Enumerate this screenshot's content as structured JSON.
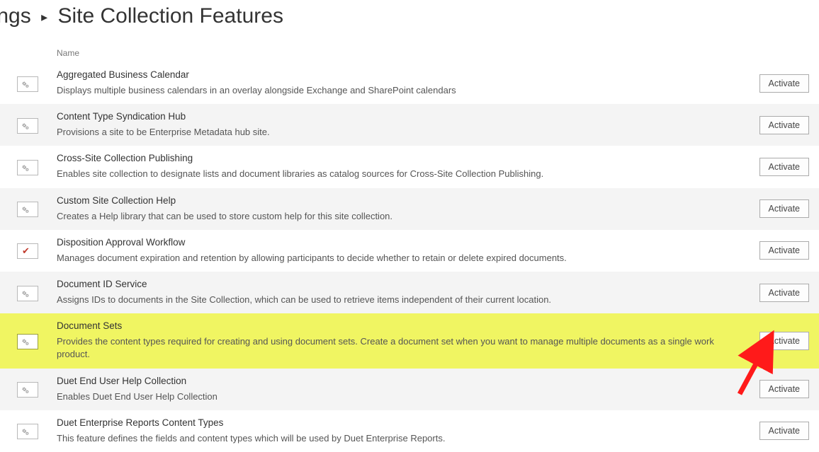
{
  "breadcrumb": {
    "prev_fragment": "ttings",
    "current": "Site Collection Features"
  },
  "columns": {
    "name": "Name"
  },
  "activate_label": "Activate",
  "features": [
    {
      "title": "Aggregated Business Calendar",
      "desc": "Displays multiple business calendars in an overlay alongside Exchange and SharePoint calendars",
      "icon": "gear",
      "alt": false,
      "highlight": false
    },
    {
      "title": "Content Type Syndication Hub",
      "desc": "Provisions a site to be Enterprise Metadata hub site.",
      "icon": "gear",
      "alt": true,
      "highlight": false
    },
    {
      "title": "Cross-Site Collection Publishing",
      "desc": "Enables site collection to designate lists and document libraries as catalog sources for Cross-Site Collection Publishing.",
      "icon": "gear",
      "alt": false,
      "highlight": false
    },
    {
      "title": "Custom Site Collection Help",
      "desc": "Creates a Help library that can be used to store custom help for this site collection.",
      "icon": "gear",
      "alt": true,
      "highlight": false
    },
    {
      "title": "Disposition Approval Workflow",
      "desc": "Manages document expiration and retention by allowing participants to decide whether to retain or delete expired documents.",
      "icon": "check",
      "alt": false,
      "highlight": false
    },
    {
      "title": "Document ID Service",
      "desc": "Assigns IDs to documents in the Site Collection, which can be used to retrieve items independent of their current location.",
      "icon": "gear",
      "alt": true,
      "highlight": false
    },
    {
      "title": "Document Sets",
      "desc": "Provides the content types required for creating and using document sets. Create a document set when you want to manage multiple documents as a single work product.",
      "icon": "gear",
      "alt": false,
      "highlight": true
    },
    {
      "title": "Duet End User Help Collection",
      "desc": "Enables Duet End User Help Collection",
      "icon": "gear",
      "alt": true,
      "highlight": false
    },
    {
      "title": "Duet Enterprise Reports Content Types",
      "desc": "This feature defines the fields and content types which will be used by Duet Enterprise Reports.",
      "icon": "gear",
      "alt": false,
      "highlight": false
    }
  ]
}
